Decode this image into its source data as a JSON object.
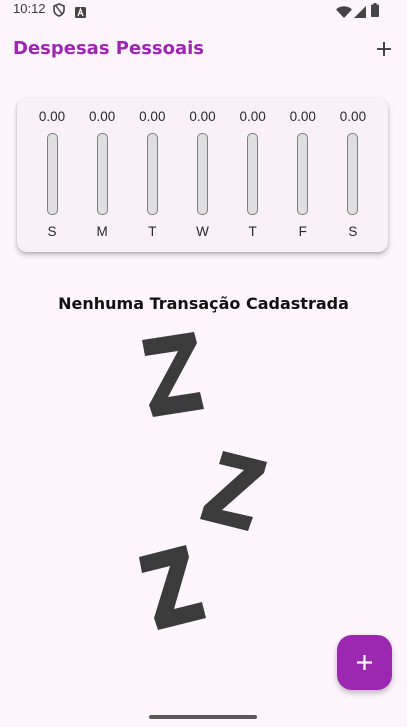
{
  "status_bar": {
    "time": "10:12",
    "left_icons": [
      "shield-icon",
      "font-a-icon"
    ],
    "right_icons": [
      "wifi-icon",
      "signal-icon",
      "battery-icon"
    ]
  },
  "app_bar": {
    "title": "Despesas Pessoais",
    "action_icon": "add-icon"
  },
  "chart": {
    "days": [
      {
        "label": "S",
        "value": "0.00",
        "fraction": 0
      },
      {
        "label": "M",
        "value": "0.00",
        "fraction": 0
      },
      {
        "label": "T",
        "value": "0.00",
        "fraction": 0
      },
      {
        "label": "W",
        "value": "0.00",
        "fraction": 0
      },
      {
        "label": "T",
        "value": "0.00",
        "fraction": 0
      },
      {
        "label": "F",
        "value": "0.00",
        "fraction": 0
      },
      {
        "label": "S",
        "value": "0.00",
        "fraction": 0
      }
    ]
  },
  "empty_state": {
    "title": "Nenhuma Transação Cadastrada",
    "image": "zzz-sleep-image"
  },
  "fab": {
    "icon": "add-icon"
  },
  "colors": {
    "accent": "#9c27b0",
    "background": "#fdf6fd",
    "card": "#f8f2f8"
  }
}
